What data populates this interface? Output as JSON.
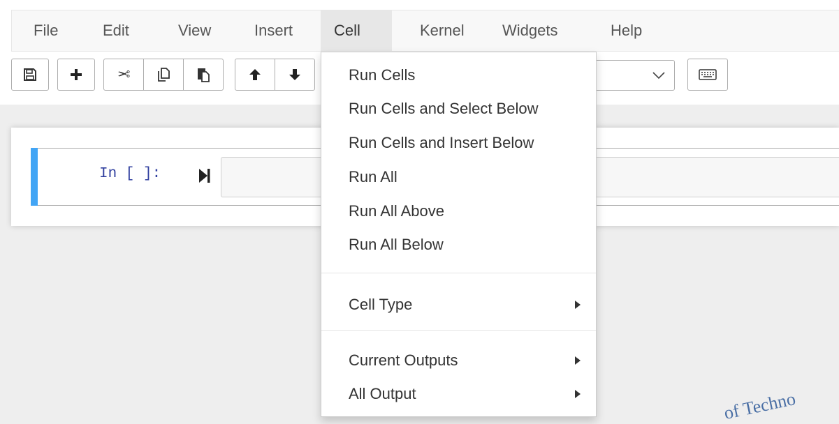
{
  "menubar": {
    "items": [
      "File",
      "Edit",
      "View",
      "Insert",
      "Cell",
      "Kernel",
      "Widgets",
      "Help"
    ],
    "active": "Cell"
  },
  "toolbar": {
    "icons": [
      "save-icon",
      "plus-icon",
      "cut-icon",
      "copy-icon",
      "paste-icon",
      "arrow-up-icon",
      "arrow-down-icon",
      "keyboard-icon"
    ]
  },
  "cell": {
    "prompt": "In [ ]:",
    "input": ""
  },
  "cell_menu": {
    "items": [
      "Run Cells",
      "Run Cells and Select Below",
      "Run Cells and Insert Below",
      "Run All",
      "Run All Above",
      "Run All Below",
      "Cell Type",
      "Current Outputs",
      "All Output"
    ],
    "submenu_items": [
      "Cell Type",
      "Current Outputs",
      "All Output"
    ]
  },
  "watermark": "of Techno",
  "colors": {
    "cell_accent": "#42a5f5",
    "prompt": "#303f9f",
    "menu_active_bg": "#e7e7e7"
  }
}
